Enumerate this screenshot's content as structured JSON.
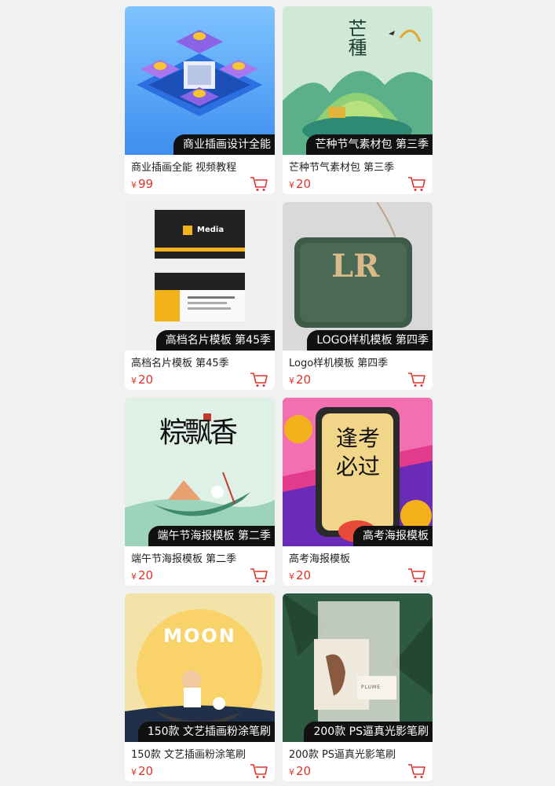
{
  "currency_symbol": "¥",
  "products": [
    {
      "banner": "商业插画设计全能",
      "title": "商业插画全能 视频教程",
      "price": "99",
      "image": "isometric-finance-illustration"
    },
    {
      "banner": "芒种节气素材包 第三季",
      "title": "芒种节气素材包 第三季",
      "price": "20",
      "image": "solar-term-landscape",
      "artwork_text": "芒種"
    },
    {
      "banner": "高档名片模板 第45季",
      "title": "高档名片模板 第45季",
      "price": "20",
      "image": "business-card-mockup",
      "artwork_text": "Media"
    },
    {
      "banner": "LOGO样机模板 第四季",
      "title": "Logo样机模板 第四季",
      "price": "20",
      "image": "leather-bag-logo-mockup",
      "artwork_text": "LR"
    },
    {
      "banner": "端午节海报模板 第二季",
      "title": "端午节海报模板 第二季",
      "price": "20",
      "image": "dragon-boat-poster",
      "artwork_text": "粽飘香"
    },
    {
      "banner": "高考海报模板",
      "title": "高考海报模板",
      "price": "20",
      "image": "exam-poster",
      "artwork_text": "逢考必过"
    },
    {
      "banner": "150款 文艺插画粉涂笔刷",
      "title": "150款 文艺插画粉涂笔刷",
      "price": "20",
      "image": "moon-festival-illustration",
      "artwork_text": "MOON"
    },
    {
      "banner": "200款 PS逼真光影笔刷",
      "title": "200款 PS逼真光影笔刷",
      "price": "20",
      "image": "shadow-brush-card",
      "artwork_text": "PLUME"
    }
  ],
  "icons": {
    "cart": "shopping-cart-icon"
  },
  "colors": {
    "price": "#e0322c",
    "banner_bg": "#111111",
    "page_bg": "#f1f1f1"
  }
}
